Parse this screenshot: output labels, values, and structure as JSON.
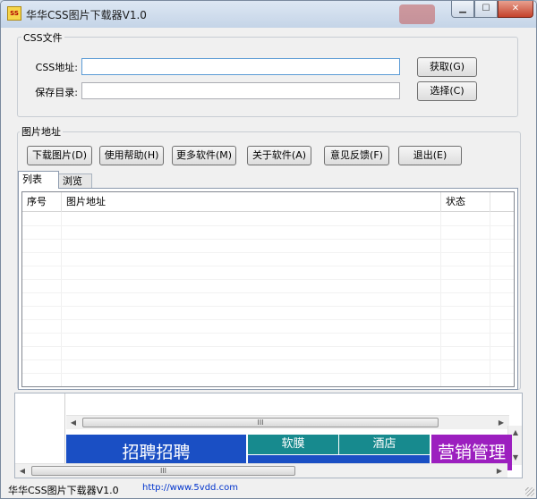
{
  "window": {
    "title": "华华CSS图片下载器V1.0",
    "icon_name": "app-icon",
    "icon_text": "SS",
    "controls": {
      "minimize": "minimize-icon",
      "maximize": "maximize-icon",
      "close": "close-icon"
    }
  },
  "css_group": {
    "label": "CSS文件",
    "css_url_label": "CSS地址:",
    "css_url_value": "",
    "save_dir_label": "保存目录:",
    "save_dir_value": "",
    "fetch_button": "获取(G)",
    "choose_button": "选择(C)"
  },
  "image_group": {
    "label": "图片地址",
    "buttons": [
      "下载图片(D)",
      "使用帮助(H)",
      "更多软件(M)",
      "关于软件(A)",
      "意见反馈(F)",
      "退出(E)"
    ]
  },
  "tabs": {
    "list": "列表",
    "browse": "浏览"
  },
  "listview": {
    "columns": [
      "序号",
      "图片地址",
      "状态"
    ]
  },
  "browser": {
    "ads": {
      "ad1": "招聘招聘",
      "ad2": "软膜",
      "ad3": "酒店",
      "ad4": "营销管理"
    },
    "scroll_grip": "III"
  },
  "status": {
    "app_name": "华华CSS图片下载器V1.0",
    "url": "http://www.5vdd.com"
  },
  "colors": {
    "ad_blue": "#1a4fc4",
    "ad_teal": "#178a8e",
    "ad_purple": "#9c1fbf",
    "link": "#0033cc"
  }
}
